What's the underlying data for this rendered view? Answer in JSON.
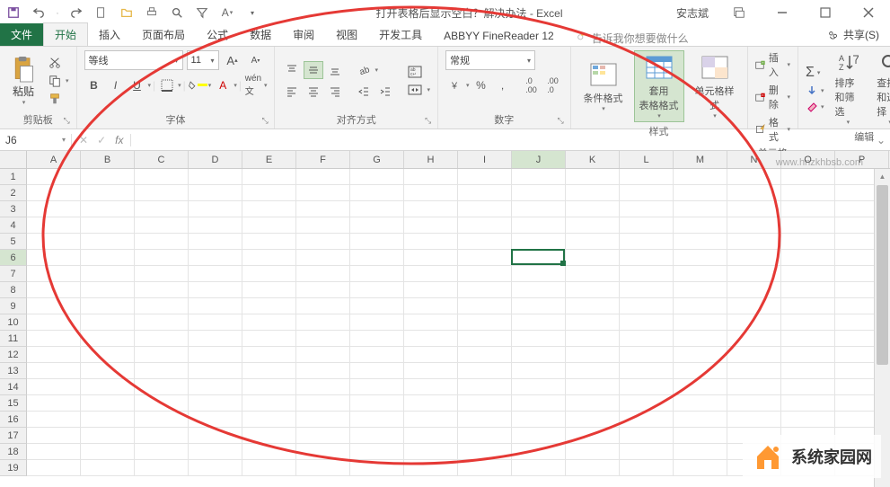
{
  "title": "打开表格后显示空白？解决办法 - Excel",
  "user": "安志斌",
  "tabs": {
    "file": "文件",
    "home": "开始",
    "insert": "插入",
    "layout": "页面布局",
    "formulas": "公式",
    "data": "数据",
    "review": "审阅",
    "view": "视图",
    "developer": "开发工具",
    "abbyy": "ABBYY FineReader 12",
    "tell_me": "告诉我你想要做什么",
    "share": "共享(S)"
  },
  "ribbon": {
    "clipboard": {
      "paste": "粘贴",
      "label": "剪贴板"
    },
    "font": {
      "name": "等线",
      "size": "11",
      "label": "字体"
    },
    "alignment": {
      "label": "对齐方式"
    },
    "number": {
      "format": "常规",
      "label": "数字"
    },
    "styles": {
      "cond": "条件格式",
      "table": "套用\n表格格式",
      "cell": "单元格样式",
      "label": "样式"
    },
    "cells": {
      "insert": "插入",
      "delete": "删除",
      "format": "格式",
      "label": "单元格"
    },
    "editing": {
      "sort": "排序和筛选",
      "find": "查找和选择",
      "label": "编辑"
    }
  },
  "formula_bar": {
    "name_box": "J6"
  },
  "grid": {
    "cols": [
      "A",
      "B",
      "C",
      "D",
      "E",
      "F",
      "G",
      "H",
      "I",
      "J",
      "K",
      "L",
      "M",
      "N",
      "O",
      "P"
    ],
    "rows": [
      1,
      2,
      3,
      4,
      5,
      6,
      7,
      8,
      9,
      10,
      11,
      12,
      13,
      14,
      15,
      16,
      17,
      18,
      19
    ],
    "selected": {
      "col": "J",
      "row": 6,
      "colIndex": 9,
      "rowIndex": 5
    }
  },
  "watermark": {
    "url": "www.hnzkhbsb.com",
    "brand": "系统家园网"
  }
}
